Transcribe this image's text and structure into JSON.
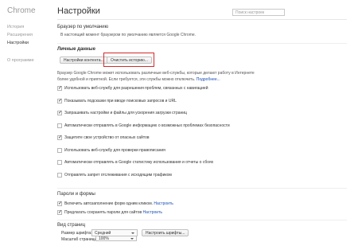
{
  "sidebar": {
    "brand": "Chrome",
    "items": [
      {
        "label": "История"
      },
      {
        "label": "Расширения"
      },
      {
        "label": "Настройки"
      }
    ],
    "about": "О программе"
  },
  "header": {
    "title": "Настройки",
    "search_placeholder": "Поиск настроек"
  },
  "default_browser": {
    "heading": "Браузер по умолчанию",
    "text": "В настоящий момент браузером по умолчанию является Google Chrome."
  },
  "personal": {
    "heading": "Личные данные",
    "content_settings_button": "Настройки контента...",
    "clear_history_button": "Очистить историю...",
    "intro_line1": "Браузер Google Chrome может использовать различные веб-службы, которые делают работу в Интернете",
    "intro_line2": "более удобной и приятной. Если требуется, эти службы можно отключить.",
    "intro_link": "Подробнее...",
    "options": [
      {
        "label": "Использовать веб-службу для разрешения проблем, связанных с навигацией",
        "checked": true
      },
      {
        "label": "Показывать подсказки при вводе поисковых запросов и URL",
        "checked": true
      },
      {
        "label": "Запрашивать настройки и файлы для ускорения загрузки страниц",
        "checked": true
      },
      {
        "label": "Автоматически отправлять в Google информацию о возможных проблемах безопасности",
        "checked": false
      },
      {
        "label": "Защитите свое устройство от опасных сайтов",
        "checked": true
      },
      {
        "label": "Использовать веб-службу для проверки правописания",
        "checked": false
      },
      {
        "label": "Автоматически отправлять в Google статистику использования и отчеты о сбоях",
        "checked": false
      },
      {
        "label": "Отправлять запрет отслеживания с исходящим трафиком",
        "checked": false
      }
    ]
  },
  "passwords": {
    "heading": "Пароли и формы",
    "autofill": {
      "label": "Включить автозаполнение форм одним кликом.",
      "link": "Настроить",
      "checked": true
    },
    "save_passwords": {
      "label": "Предлагать сохранять пароли для сайтов",
      "link": "Настроить",
      "checked": true
    }
  },
  "appearance": {
    "heading": "Вид страниц",
    "font_size_label": "Размер шрифта:",
    "font_size_value": "Средний",
    "font_settings_button": "Настроить шрифты...",
    "zoom_label": "Масштаб страницы:",
    "zoom_value": "100%"
  },
  "colors": {
    "highlight_box": "#d42a2a",
    "link": "#1a4fb5"
  }
}
